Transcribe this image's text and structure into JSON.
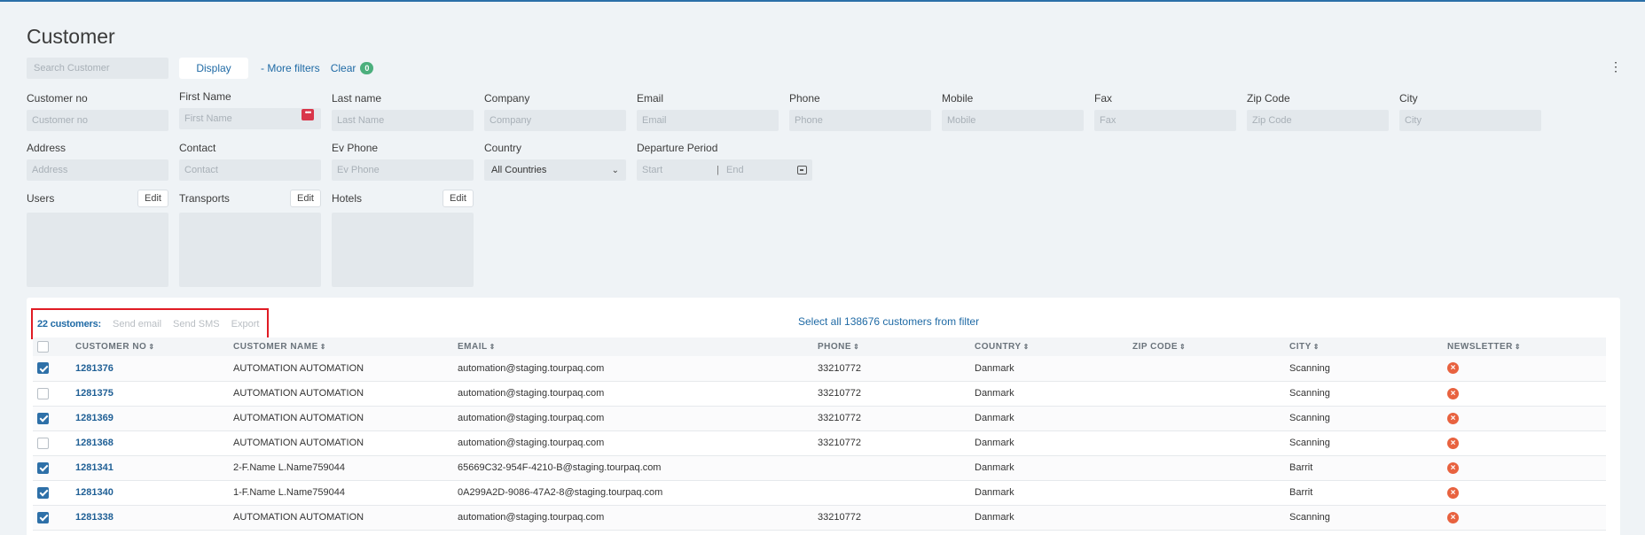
{
  "page": {
    "title": "Customer"
  },
  "toolbar": {
    "search_placeholder": "Search Customer",
    "display_label": "Display",
    "more_filters_label": "- More filters",
    "clear_label": "Clear",
    "clear_count": "0"
  },
  "filters": {
    "customer_no": {
      "label": "Customer no",
      "placeholder": "Customer no"
    },
    "first_name": {
      "label": "First Name",
      "placeholder": "First Name"
    },
    "last_name": {
      "label": "Last name",
      "placeholder": "Last Name"
    },
    "company": {
      "label": "Company",
      "placeholder": "Company"
    },
    "email": {
      "label": "Email",
      "placeholder": "Email"
    },
    "phone": {
      "label": "Phone",
      "placeholder": "Phone"
    },
    "mobile": {
      "label": "Mobile",
      "placeholder": "Mobile"
    },
    "fax": {
      "label": "Fax",
      "placeholder": "Fax"
    },
    "zip_code": {
      "label": "Zip Code",
      "placeholder": "Zip Code"
    },
    "city": {
      "label": "City",
      "placeholder": "City"
    },
    "address": {
      "label": "Address",
      "placeholder": "Address"
    },
    "contact": {
      "label": "Contact",
      "placeholder": "Contact"
    },
    "ev_phone": {
      "label": "Ev Phone",
      "placeholder": "Ev Phone"
    },
    "country": {
      "label": "Country",
      "value": "All Countries"
    },
    "departure_period": {
      "label": "Departure Period",
      "start_placeholder": "Start",
      "separator": "|",
      "end_placeholder": "End"
    }
  },
  "lists": {
    "users": {
      "label": "Users",
      "edit_label": "Edit"
    },
    "transports": {
      "label": "Transports",
      "edit_label": "Edit"
    },
    "hotels": {
      "label": "Hotels",
      "edit_label": "Edit"
    }
  },
  "results": {
    "count_label": "22 customers:",
    "actions": {
      "send_email": "Send email",
      "send_sms": "Send SMS",
      "export": "Export"
    },
    "select_all_label": "Select all 138676 customers from filter",
    "columns": [
      "CUSTOMER NO",
      "CUSTOMER NAME",
      "EMAIL",
      "PHONE",
      "COUNTRY",
      "ZIP CODE",
      "CITY",
      "NEWSLETTER"
    ],
    "rows": [
      {
        "checked": true,
        "customer_no": "1281376",
        "name": "AUTOMATION AUTOMATION",
        "email": "automation@staging.tourpaq.com",
        "phone": "33210772",
        "country": "Danmark",
        "zip": "",
        "city": "Scanning"
      },
      {
        "checked": false,
        "customer_no": "1281375",
        "name": "AUTOMATION AUTOMATION",
        "email": "automation@staging.tourpaq.com",
        "phone": "33210772",
        "country": "Danmark",
        "zip": "",
        "city": "Scanning"
      },
      {
        "checked": true,
        "customer_no": "1281369",
        "name": "AUTOMATION AUTOMATION",
        "email": "automation@staging.tourpaq.com",
        "phone": "33210772",
        "country": "Danmark",
        "zip": "",
        "city": "Scanning"
      },
      {
        "checked": false,
        "customer_no": "1281368",
        "name": "AUTOMATION AUTOMATION",
        "email": "automation@staging.tourpaq.com",
        "phone": "33210772",
        "country": "Danmark",
        "zip": "",
        "city": "Scanning"
      },
      {
        "checked": true,
        "customer_no": "1281341",
        "name": "2-F.Name L.Name759044",
        "email": "65669C32-954F-4210-B@staging.tourpaq.com",
        "phone": "",
        "country": "Danmark",
        "zip": "",
        "city": "Barrit"
      },
      {
        "checked": true,
        "customer_no": "1281340",
        "name": "1-F.Name L.Name759044",
        "email": "0A299A2D-9086-47A2-8@staging.tourpaq.com",
        "phone": "",
        "country": "Danmark",
        "zip": "",
        "city": "Barrit"
      },
      {
        "checked": true,
        "customer_no": "1281338",
        "name": "AUTOMATION AUTOMATION",
        "email": "automation@staging.tourpaq.com",
        "phone": "33210772",
        "country": "Danmark",
        "zip": "",
        "city": "Scanning"
      }
    ]
  }
}
